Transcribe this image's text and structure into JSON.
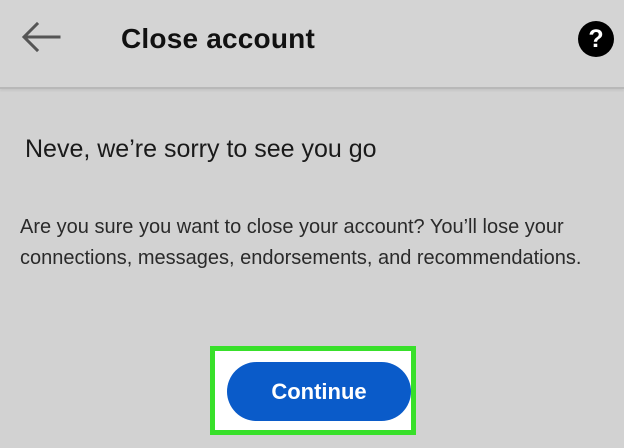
{
  "header": {
    "back_icon": "arrow-left-icon",
    "title": "Close account",
    "help_icon": "question-circle-icon",
    "help_glyph": "?"
  },
  "main": {
    "heading": "Neve, we’re sorry to see you go",
    "message": "Are you sure you want to close your account? You’ll lose your connections, messages, endorsements, and recommendations.",
    "continue_label": "Continue"
  },
  "colors": {
    "background": "#d2d2d2",
    "primary_button": "#0a5bc9",
    "highlight": "#38e02a"
  }
}
